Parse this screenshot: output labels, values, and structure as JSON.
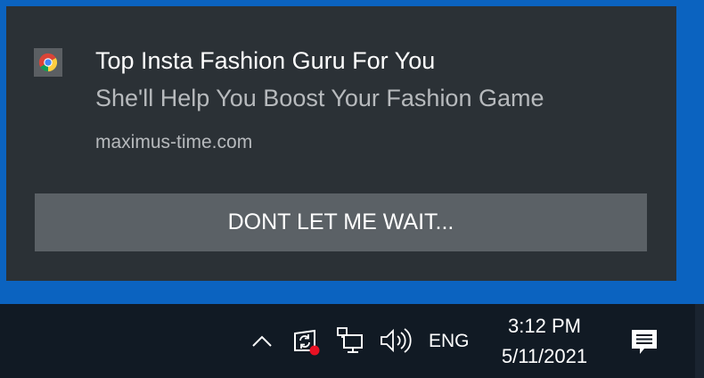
{
  "notification": {
    "app_icon": "chrome-icon",
    "title": "Top Insta Fashion Guru For You",
    "body": "She'll Help You Boost Your Fashion Game",
    "source": "maximus-time.com",
    "action_label": "DONT LET ME WAIT..."
  },
  "taskbar": {
    "tray_icons": [
      "chevron-up-icon",
      "windows-update-icon",
      "network-icon",
      "volume-icon"
    ],
    "language": "ENG",
    "time": "3:12 PM",
    "date": "5/11/2021",
    "action_center_icon": "action-center-icon"
  },
  "colors": {
    "desktop": "#0b63c0",
    "toast_background": "#2b3136",
    "action_button": "#5b6166",
    "taskbar": "#111a24",
    "update_badge": "#e81123"
  }
}
